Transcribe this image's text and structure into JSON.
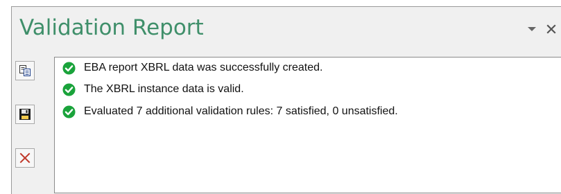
{
  "panel": {
    "title": "Validation Report",
    "controls": [
      {
        "icon": "dropdown-triangle-icon"
      },
      {
        "icon": "close-icon"
      }
    ]
  },
  "toolbar": {
    "buttons": [
      {
        "icon": "copy-icon"
      },
      {
        "icon": "save-icon"
      },
      {
        "icon": "clear-icon"
      }
    ]
  },
  "messages": [
    {
      "status": "success",
      "text": "EBA report XBRL data was successfully created."
    },
    {
      "status": "success",
      "text": "The XBRL instance data is valid."
    },
    {
      "status": "success",
      "text": "Evaluated 7 additional validation rules: 7 satisfied, 0 unsatisfied."
    }
  ],
  "colors": {
    "title": "#3f8f6a",
    "success": "#1aa33b",
    "clear": "#c0392b"
  }
}
